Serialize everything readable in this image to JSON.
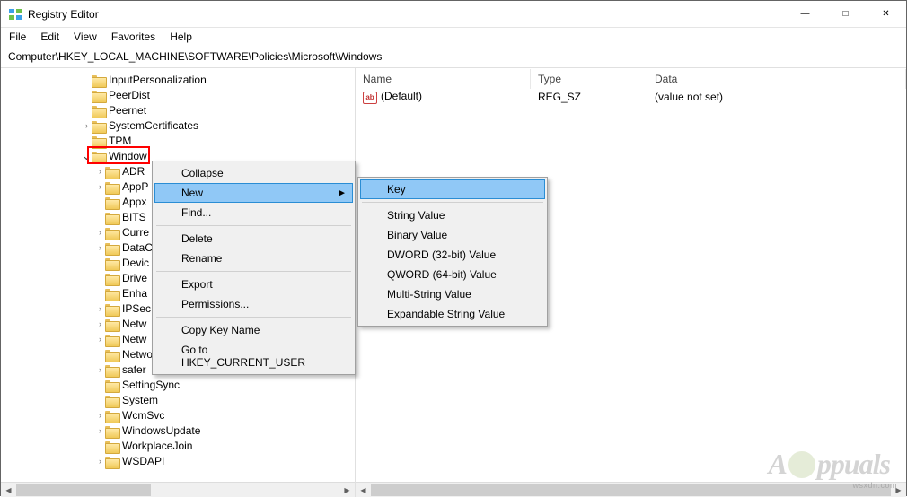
{
  "titlebar": {
    "title": "Registry Editor"
  },
  "menubar": {
    "file": "File",
    "edit": "Edit",
    "view": "View",
    "favorites": "Favorites",
    "help": "Help"
  },
  "address": "Computer\\HKEY_LOCAL_MACHINE\\SOFTWARE\\Policies\\Microsoft\\Windows",
  "tree": {
    "items": [
      {
        "label": "InputPersonalization",
        "indent": 6,
        "chev": ""
      },
      {
        "label": "PeerDist",
        "indent": 6,
        "chev": ""
      },
      {
        "label": "Peernet",
        "indent": 6,
        "chev": ""
      },
      {
        "label": "SystemCertificates",
        "indent": 6,
        "chev": ">"
      },
      {
        "label": "TPM",
        "indent": 6,
        "chev": ""
      },
      {
        "label": "Window",
        "indent": 6,
        "chev": "v",
        "selected": true
      },
      {
        "label": "ADR",
        "indent": 7,
        "chev": ">"
      },
      {
        "label": "AppP",
        "indent": 7,
        "chev": ">"
      },
      {
        "label": "Appx",
        "indent": 7,
        "chev": ""
      },
      {
        "label": "BITS",
        "indent": 7,
        "chev": ""
      },
      {
        "label": "Curre",
        "indent": 7,
        "chev": ">"
      },
      {
        "label": "DataC",
        "indent": 7,
        "chev": ">"
      },
      {
        "label": "Devic",
        "indent": 7,
        "chev": ""
      },
      {
        "label": "Drive",
        "indent": 7,
        "chev": ""
      },
      {
        "label": "Enha",
        "indent": 7,
        "chev": ""
      },
      {
        "label": "IPSec",
        "indent": 7,
        "chev": ">"
      },
      {
        "label": "Netw",
        "indent": 7,
        "chev": ">"
      },
      {
        "label": "Netw",
        "indent": 7,
        "chev": ">"
      },
      {
        "label": "NetworkProvider",
        "indent": 7,
        "chev": ""
      },
      {
        "label": "safer",
        "indent": 7,
        "chev": ">"
      },
      {
        "label": "SettingSync",
        "indent": 7,
        "chev": ""
      },
      {
        "label": "System",
        "indent": 7,
        "chev": ""
      },
      {
        "label": "WcmSvc",
        "indent": 7,
        "chev": ">"
      },
      {
        "label": "WindowsUpdate",
        "indent": 7,
        "chev": ">"
      },
      {
        "label": "WorkplaceJoin",
        "indent": 7,
        "chev": ""
      },
      {
        "label": "WSDAPI",
        "indent": 7,
        "chev": ">"
      }
    ]
  },
  "list": {
    "columns": {
      "name": "Name",
      "type": "Type",
      "data": "Data"
    },
    "rows": [
      {
        "name": "(Default)",
        "type": "REG_SZ",
        "data": "(value not set)"
      }
    ]
  },
  "context_main": {
    "collapse": "Collapse",
    "new": "New",
    "find": "Find...",
    "delete": "Delete",
    "rename": "Rename",
    "export": "Export",
    "permissions": "Permissions...",
    "copy_key_name": "Copy Key Name",
    "goto_hkcu": "Go to HKEY_CURRENT_USER"
  },
  "context_new": {
    "key": "Key",
    "string": "String Value",
    "binary": "Binary Value",
    "dword": "DWORD (32-bit) Value",
    "qword": "QWORD (64-bit) Value",
    "multistring": "Multi-String Value",
    "expandable": "Expandable String Value"
  },
  "watermark": "wsxdn.com",
  "logo": "ppuals"
}
